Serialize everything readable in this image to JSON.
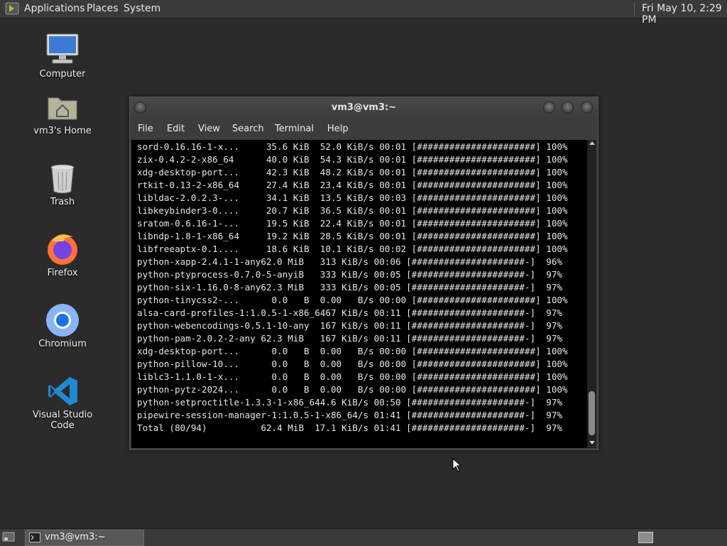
{
  "top_panel": {
    "menus": [
      "Applications",
      "Places",
      "System"
    ],
    "clock": "Fri May 10,  2:29 PM"
  },
  "desktop_icons": [
    {
      "label": "Computer",
      "icon": "computer-icon"
    },
    {
      "label": "vm3's Home",
      "icon": "home-folder-icon"
    },
    {
      "label": "Trash",
      "icon": "trash-icon"
    },
    {
      "label": "Firefox",
      "icon": "firefox-icon"
    },
    {
      "label": "Chromium",
      "icon": "chromium-icon"
    },
    {
      "label": "Visual Studio Code",
      "icon": "vscode-icon"
    }
  ],
  "terminal": {
    "title": "vm3@vm3:~",
    "menu": [
      "File",
      "Edit",
      "View",
      "Search",
      "Terminal",
      "Help"
    ],
    "lines": [
      "sord-0.16.16-1-x...     35.6 KiB  52.0 KiB/s 00:01 [######################] 100%",
      "zix-0.4.2-2-x86_64      40.0 KiB  54.3 KiB/s 00:01 [######################] 100%",
      "xdg-desktop-port...     42.3 KiB  48.2 KiB/s 00:01 [######################] 100%",
      "rtkit-0.13-2-x86_64     27.4 KiB  23.4 KiB/s 00:01 [######################] 100%",
      "libldac-2.0.2.3-...     34.1 KiB  13.5 KiB/s 00:03 [######################] 100%",
      "libkeybinder3-0....     20.7 KiB  36.5 KiB/s 00:01 [######################] 100%",
      "sratom-0.6.16-1-...     19.5 KiB  22.4 KiB/s 00:01 [######################] 100%",
      "libndp-1.8-1-x86_64     19.2 KiB  28.5 KiB/s 00:01 [######################] 100%",
      "libfreeaptx-0.1....     18.6 KiB  10.1 KiB/s 00:02 [######################] 100%",
      "python-xapp-2.4.1-1-any62.0 MiB   313 KiB/s 00:06 [#####################-]  96%",
      "python-ptyprocess-0.7.0-5-anyiB   333 KiB/s 00:05 [#####################-]  97%",
      "python-six-1.16.0-8-any62.3 MiB   333 KiB/s 00:05 [#####################-]  97%",
      "python-tinycss2-...      0.0   B  0.00   B/s 00:00 [######################] 100%",
      "alsa-card-profiles-1:1.0.5-1-x86_6467 KiB/s 00:11 [#####################-]  97%",
      "python-webencodings-0.5.1-10-any  167 KiB/s 00:11 [#####################-]  97%",
      "python-pam-2.0.2-2-any 62.3 MiB   167 KiB/s 00:11 [#####################-]  97%",
      "xdg-desktop-port...      0.0   B  0.00   B/s 00:00 [######################] 100%",
      "python-pillow-10...      0.0   B  0.00   B/s 00:00 [######################] 100%",
      "liblc3-1.1.0-1-x...      0.0   B  0.00   B/s 00:00 [######################] 100%",
      "python-pytz-2024...      0.0   B  0.00   B/s 00:00 [######################] 100%",
      "python-setproctitle-1.3.3-1-x86_644.6 KiB/s 00:50 [#####################-]  97%",
      "pipewire-session-manager-1:1.0.5-1-x86_64/s 01:41 [#####################-]  97%",
      "Total (80/94)          62.4 MiB  17.1 KiB/s 01:41 [#####################-]  97%"
    ]
  },
  "taskbar": {
    "window_button": "vm3@vm3:~"
  }
}
